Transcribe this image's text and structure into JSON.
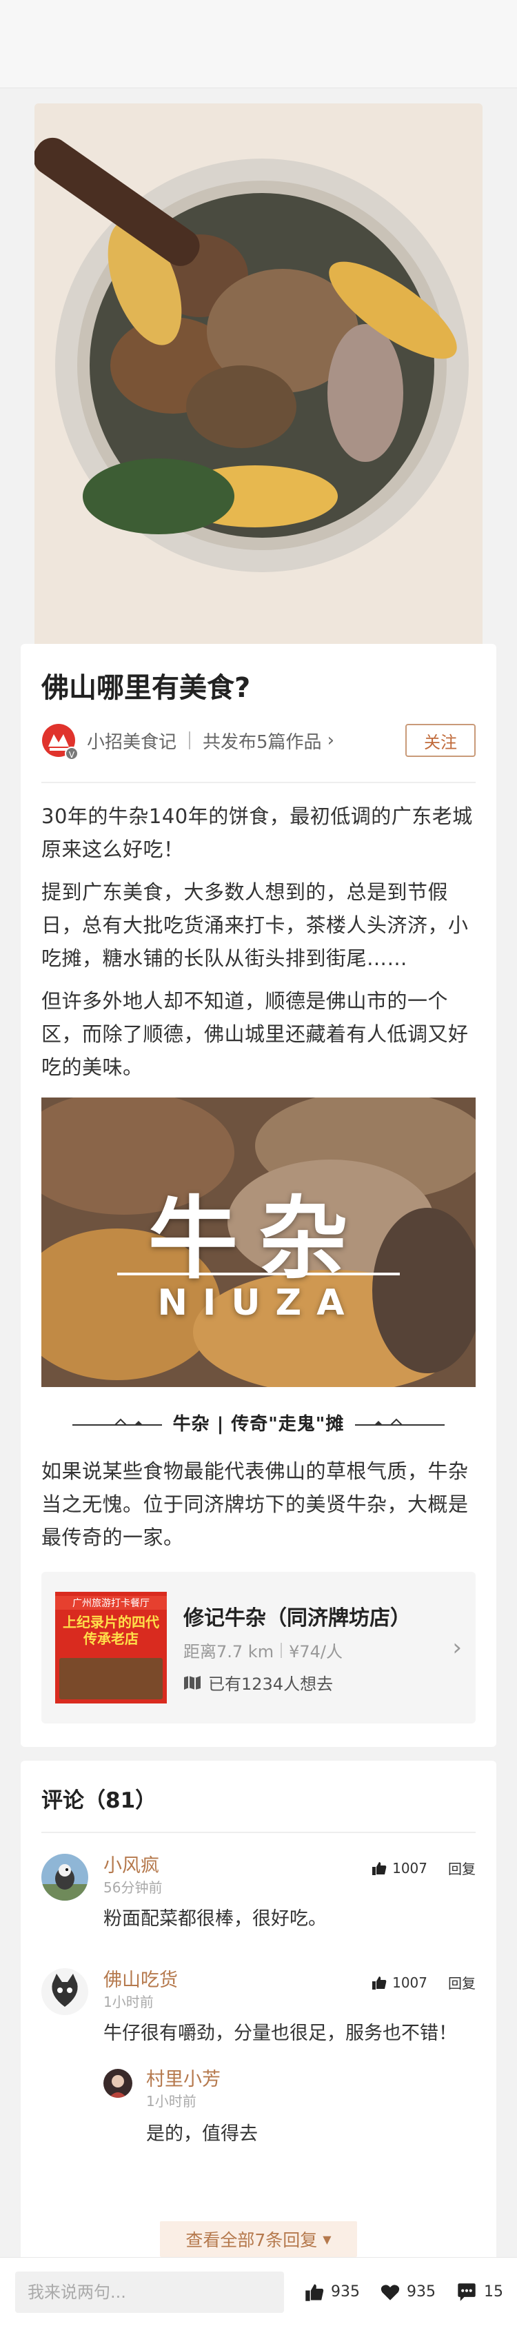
{
  "article": {
    "title": "佛山哪里有美食?",
    "author": {
      "name": "小招美食记",
      "works": "共发布5篇作品",
      "follow_label": "关注"
    },
    "paragraphs": [
      "30年的牛杂140年的饼食，最初低调的广东老城原来这么好吃！",
      "提到广东美食，大多数人想到的，总是到节假日，总有大批吃货涌来打卡，茶楼人头济济，小吃摊，糖水铺的长队从街头排到街尾……",
      "但许多外地人却不知道，顺德是佛山市的一个区，而除了顺德，佛山城里还藏着有人低调又好吃的美味。"
    ],
    "inline_image": {
      "title": "牛杂",
      "subtitle": "NIUZA"
    },
    "section_caption": "牛杂 | 传奇\"走鬼\"摊",
    "paragraph_after": "如果说某些食物最能代表佛山的草根气质，牛杂当之无愧。位于同济牌坊下的美贤牛杂，大概是最传奇的一家。",
    "poi": {
      "image_tag": "广州旅游打卡餐厅",
      "image_banner": "上纪录片的四代传承老店",
      "name": "修记牛杂（同济牌坊店）",
      "distance": "距离7.7 km",
      "price": "¥74/人",
      "want": "已有1234人想去"
    }
  },
  "comments": {
    "title": "评论（81）",
    "items": [
      {
        "name": "小风疯",
        "time": "56分钟前",
        "text": "粉面配菜都很棒，很好吃。",
        "likes": "1007",
        "reply_label": "回复"
      },
      {
        "name": "佛山吃货",
        "time": "1小时前",
        "text": "牛仔很有嚼劲，分量也很足，服务也不错！",
        "likes": "1007",
        "reply_label": "回复",
        "reply": {
          "name": "村里小芳",
          "time": "1小时前",
          "text": "是的，值得去"
        }
      }
    ],
    "view_all": "查看全部7条回复"
  },
  "bottom_bar": {
    "input_placeholder": "我来说两句...",
    "likes": "935",
    "favorites": "935",
    "comments": "15"
  },
  "colors": {
    "accent": "#b5794d",
    "follow_text": "#c06b3b",
    "page_bg": "#f2f2f2"
  }
}
